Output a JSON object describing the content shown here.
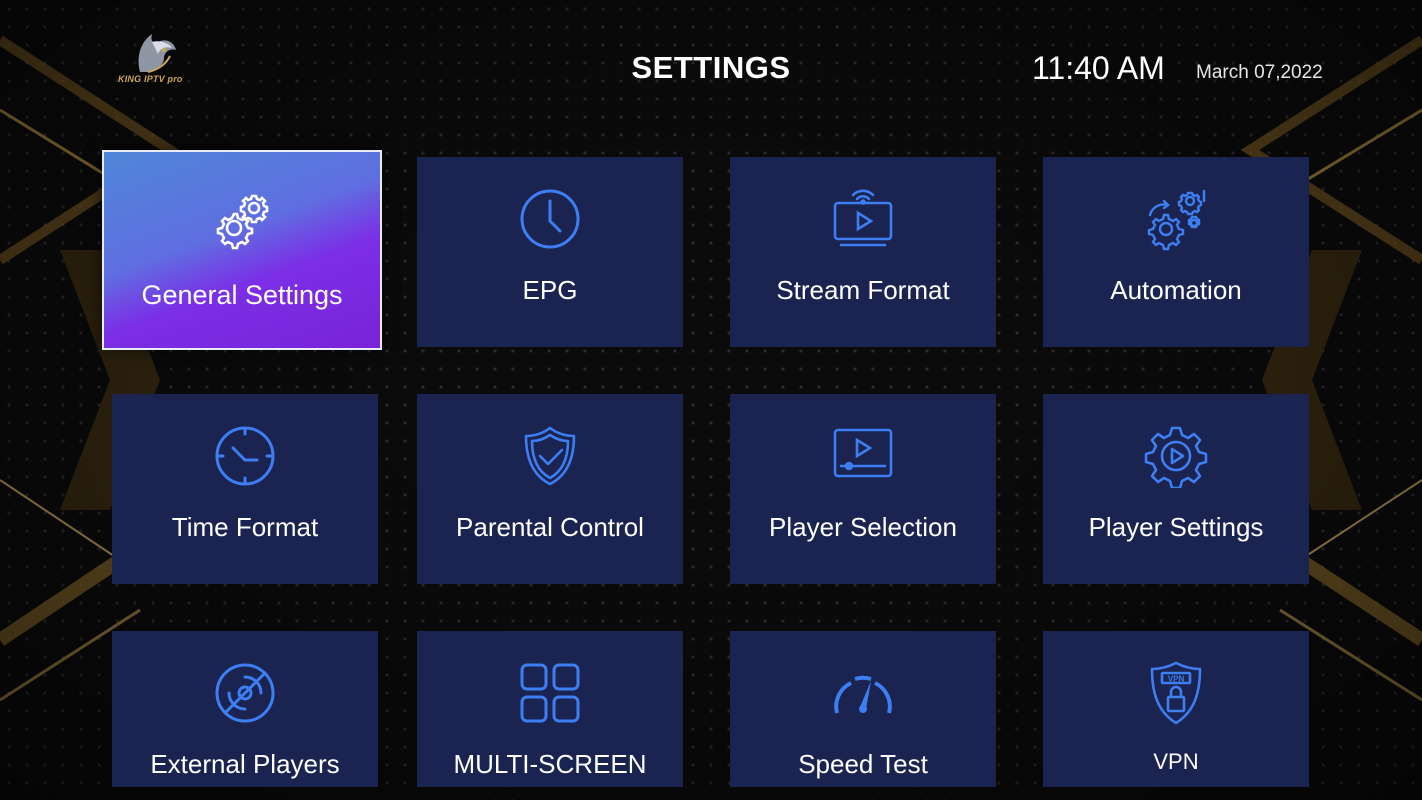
{
  "header": {
    "logo_text": "KING IPTV pro",
    "title": "SETTINGS",
    "time": "11:40 AM",
    "date": "March 07,2022"
  },
  "colors": {
    "tile_bg": "#1b2450",
    "icon_blue": "#3d7ef2",
    "accent_gold": "#c9a65a",
    "focus_gradient_start": "#4f86d8",
    "focus_gradient_end": "#7a22d8"
  },
  "tiles": [
    {
      "label": "General Settings",
      "icon": "gears-icon",
      "focused": true
    },
    {
      "label": "EPG",
      "icon": "clock-icon"
    },
    {
      "label": "Stream Format",
      "icon": "stream-screen-icon"
    },
    {
      "label": "Automation",
      "icon": "automation-gears-icon"
    },
    {
      "label": "Time Format",
      "icon": "time-clock-icon"
    },
    {
      "label": "Parental Control",
      "icon": "shield-check-icon"
    },
    {
      "label": "Player Selection",
      "icon": "video-player-icon"
    },
    {
      "label": "Player Settings",
      "icon": "gear-play-icon"
    },
    {
      "label": "External Players",
      "icon": "disc-off-icon"
    },
    {
      "label": "MULTI-SCREEN",
      "icon": "grid-icon"
    },
    {
      "label": "Speed Test",
      "icon": "speedometer-icon"
    },
    {
      "label": "VPN",
      "icon": "vpn-lock-icon"
    }
  ]
}
